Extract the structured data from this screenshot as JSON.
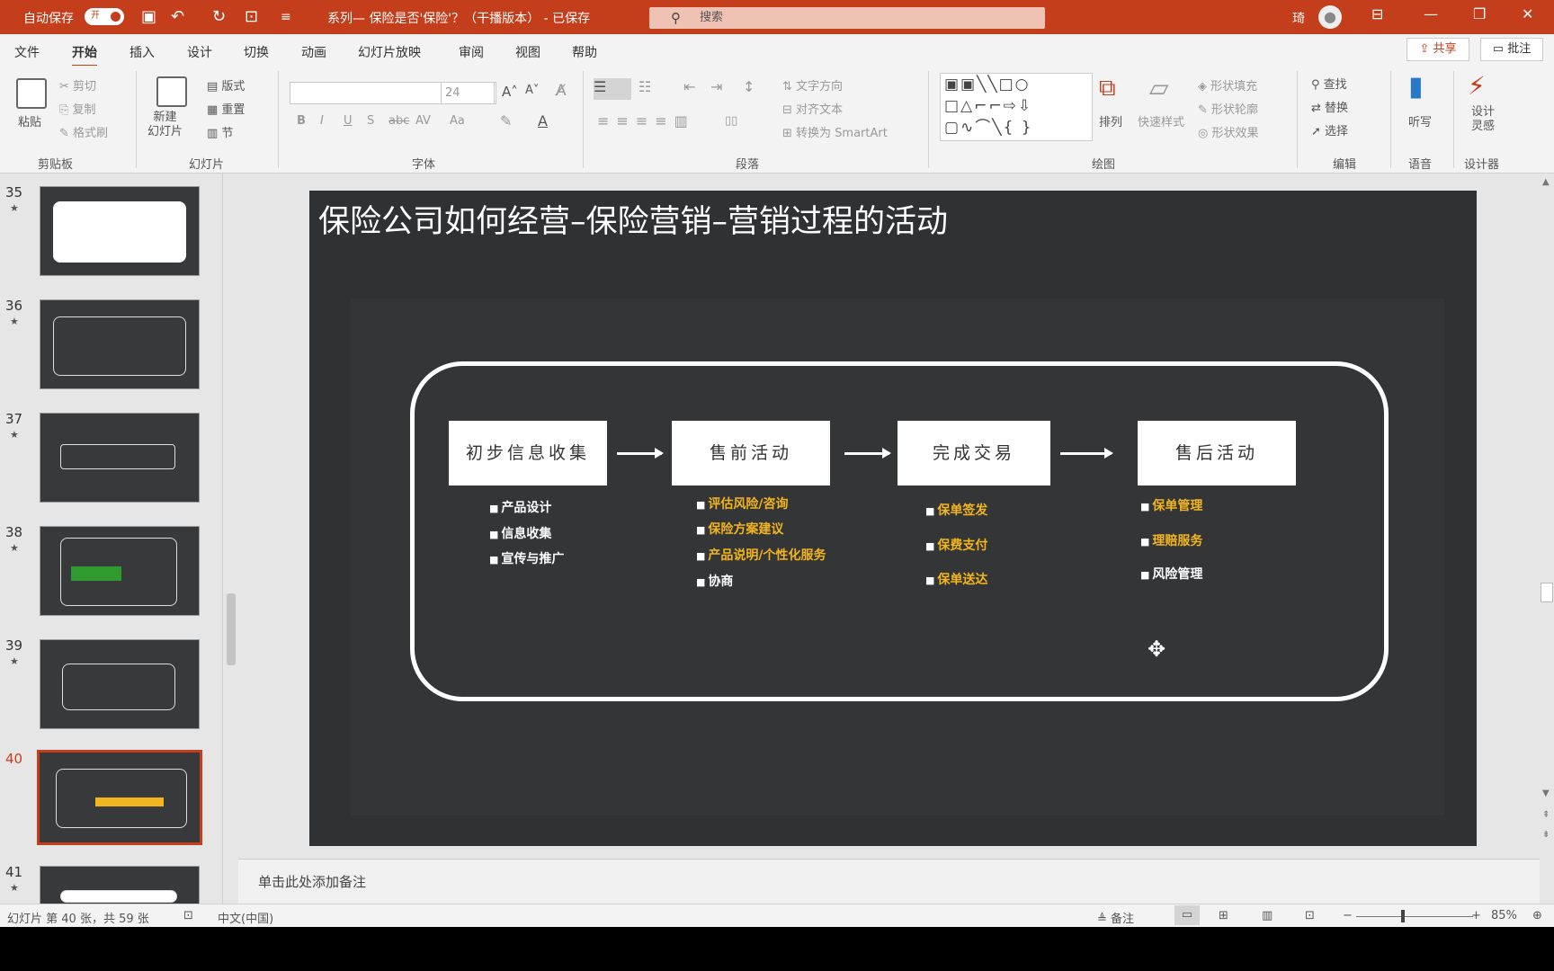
{
  "titlebar": {
    "autosave_label": "自动保存",
    "autosave_state": "开",
    "doc_title": "系列— 保险是否'保险'？（干播版本） - 已保存",
    "search_placeholder": "搜索",
    "user_name": "琦"
  },
  "tabs": [
    "文件",
    "开始",
    "插入",
    "设计",
    "切换",
    "动画",
    "幻灯片放映",
    "审阅",
    "视图",
    "帮助"
  ],
  "share_label": "共享",
  "comment_label": "批注",
  "ribbon": {
    "clipboard": {
      "paste": "粘贴",
      "cut": "剪切",
      "copy": "复制",
      "format_painter": "格式刷",
      "label": "剪贴板"
    },
    "slides": {
      "new_slide": "新建\n幻灯片",
      "layout": "版式",
      "reset": "重置",
      "section": "节",
      "label": "幻灯片"
    },
    "font": {
      "size": "24",
      "label": "字体"
    },
    "paragraph": {
      "text_direction": "文字方向",
      "align_text": "对齐文本",
      "convert_smartart": "转换为 SmartArt",
      "label": "段落"
    },
    "drawing": {
      "arrange": "排列",
      "quick_styles": "快速样式",
      "shape_fill": "形状填充",
      "shape_outline": "形状轮廓",
      "shape_effects": "形状效果",
      "label": "绘图"
    },
    "editing": {
      "find": "查找",
      "replace": "替换",
      "select": "选择",
      "label": "编辑"
    },
    "voice": {
      "dictate": "听写",
      "label": "语音"
    },
    "designer": {
      "design_ideas": "设计\n灵感",
      "label": "设计器"
    }
  },
  "thumbnails": [
    {
      "num": "35",
      "star": "★"
    },
    {
      "num": "36",
      "star": "★"
    },
    {
      "num": "37",
      "star": "★"
    },
    {
      "num": "38",
      "star": "★"
    },
    {
      "num": "39",
      "star": "★"
    },
    {
      "num": "40",
      "star": ""
    },
    {
      "num": "41",
      "star": "★"
    }
  ],
  "slide": {
    "title": "保险公司如何经营–保险营销–营销过程的活动",
    "steps": [
      {
        "label": "初步信息收集"
      },
      {
        "label": "售前活动"
      },
      {
        "label": "完成交易"
      },
      {
        "label": "售后活动"
      }
    ],
    "bullets": [
      [
        {
          "text": "产品设计",
          "highlight": false
        },
        {
          "text": "信息收集",
          "highlight": false
        },
        {
          "text": "宣传与推广",
          "highlight": false
        }
      ],
      [
        {
          "text": "评估风险/咨询",
          "highlight": true
        },
        {
          "text": "保险方案建议",
          "highlight": true
        },
        {
          "text": "产品说明/个性化服务",
          "highlight": true
        },
        {
          "text": "协商",
          "highlight": false
        }
      ],
      [
        {
          "text": "保单签发",
          "highlight": true
        },
        {
          "text": "保费支付",
          "highlight": true
        },
        {
          "text": "保单送达",
          "highlight": true
        }
      ],
      [
        {
          "text": "保单管理",
          "highlight": true
        },
        {
          "text": "理赔服务",
          "highlight": true
        },
        {
          "text": "风险管理",
          "highlight": false
        }
      ]
    ],
    "highlight_color": "#f2b51d"
  },
  "notes_placeholder": "单击此处添加备注",
  "status": {
    "slide_info": "幻灯片 第 40 张，共 59 张",
    "language": "中文(中国)",
    "notes_btn": "备注",
    "zoom": "85%"
  }
}
